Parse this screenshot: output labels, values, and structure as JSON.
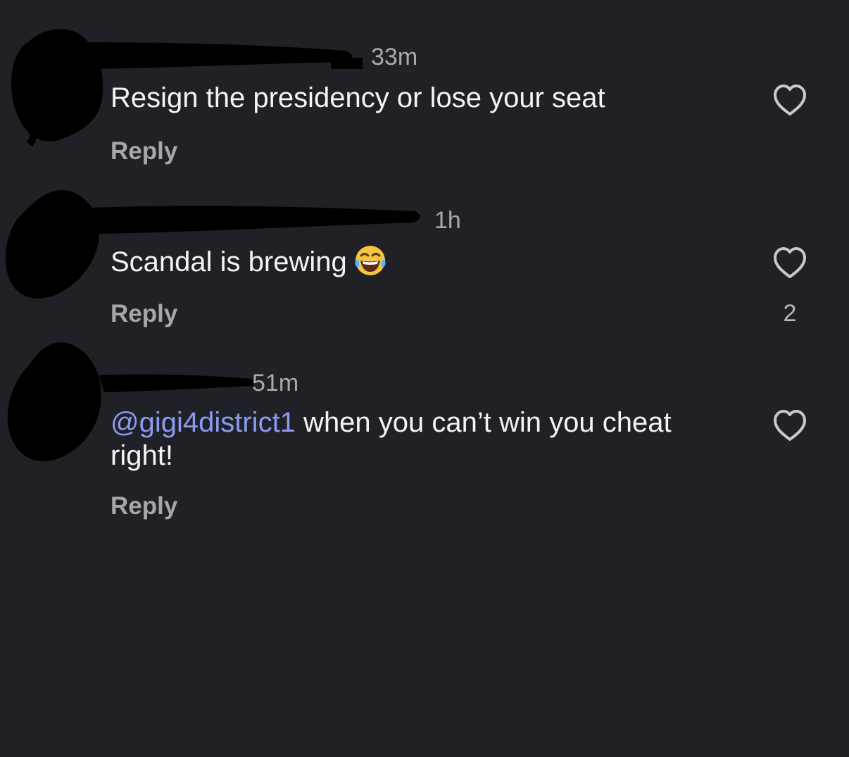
{
  "comments": [
    {
      "time": "33m",
      "text": "Resign the presidency or lose your seat",
      "reply_label": "Reply",
      "like_count": ""
    },
    {
      "time": "1h",
      "text": "Scandal is brewing",
      "emoji": "😂",
      "reply_label": "Reply",
      "like_count": "2"
    },
    {
      "time": "51m",
      "mention": "@gigi4district1",
      "text": " when you can’t win you cheat right!",
      "reply_label": "Reply",
      "like_count": ""
    }
  ],
  "icons": {
    "like": "heart-outline-icon",
    "emoji": "face-with-tears-of-joy"
  },
  "colors": {
    "background": "#202127",
    "mention": "#8c9bf2",
    "muted": "#a6a7ad"
  }
}
